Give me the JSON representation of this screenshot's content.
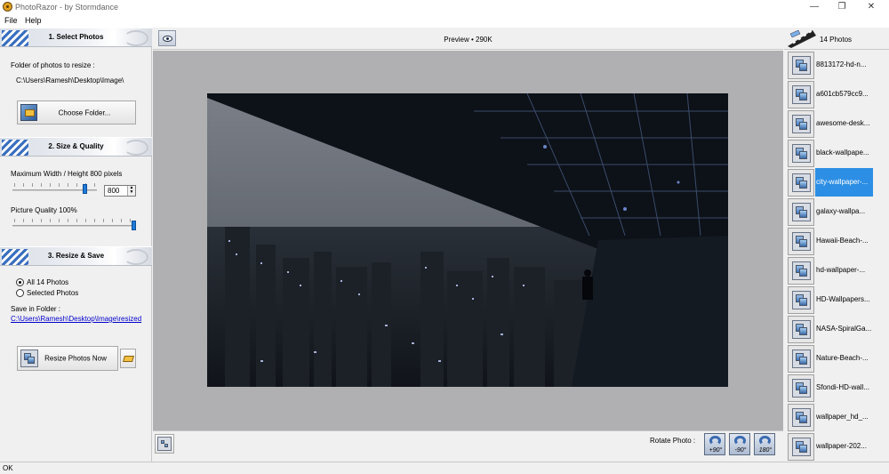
{
  "window": {
    "title": "PhotoRazor - by Stormdance",
    "minimize": "—",
    "restore": "❐",
    "close": "✕"
  },
  "menu": [
    "File",
    "Help"
  ],
  "select_photos": {
    "heading": "1. Select Photos",
    "folder_label": "Folder of photos to resize :",
    "folder_path": "C:\\Users\\Ramesh\\Desktop\\Image\\",
    "choose_button": "Choose Folder..."
  },
  "size_quality": {
    "heading": "2. Size & Quality",
    "max_label": "Maximum Width / Height 800 pixels",
    "max_value": "800",
    "quality_label": "Picture Quality 100%",
    "max_slider_fraction": 0.88,
    "quality_slider_fraction": 1.0
  },
  "resize_save": {
    "heading": "3. Resize & Save",
    "option_all": "All 14 Photos",
    "option_selected": "Selected Photos",
    "save_label": "Save in Folder :",
    "save_path": "C:\\Users\\Ramesh\\Desktop\\Image\\resized",
    "resize_button": "Resize Photos Now"
  },
  "preview": {
    "title": "Preview • 290K",
    "rotate_label": "Rotate Photo :",
    "rotate_buttons": [
      "+90°",
      "-90°",
      "180°"
    ]
  },
  "photos": {
    "count_label": "14 Photos",
    "selected_index": 4,
    "items": [
      "8813172-hd-n...",
      "a601cb579cc9...",
      "awesome-desk...",
      "black-wallpape...",
      "city-wallpaper-...",
      "galaxy-wallpa...",
      "Hawaii-Beach-...",
      "hd-wallpaper-...",
      "HD-Wallpapers...",
      "NASA-SpiralGa...",
      "Nature-Beach-...",
      "Sfondi-HD-wall...",
      "wallpaper_hd_...",
      "wallpaper-202..."
    ]
  },
  "status": "OK"
}
